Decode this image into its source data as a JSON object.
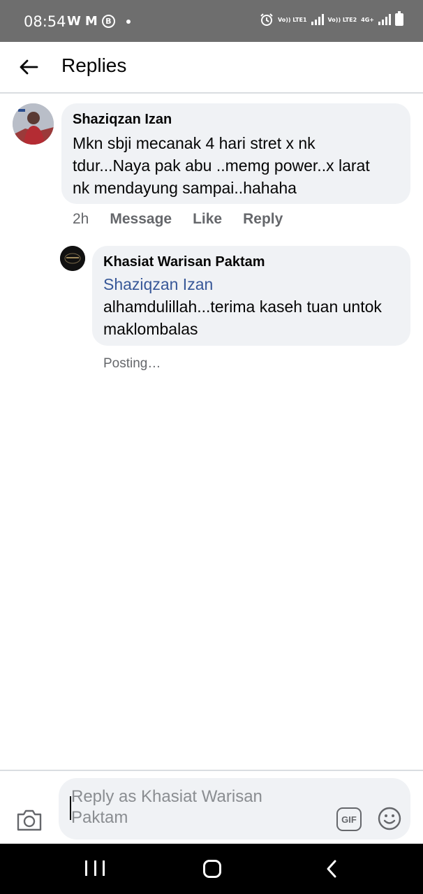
{
  "status_bar": {
    "time": "08:54",
    "left_icons": [
      "W",
      "M",
      "B"
    ],
    "network_1": "Vo)) LTE1",
    "network_2": "Vo)) LTE2",
    "network_3": "4G+"
  },
  "header": {
    "title": "Replies",
    "back_icon": "arrow-left-icon"
  },
  "comments": [
    {
      "author": "Shaziqzan Izan",
      "text": "Mkn sbji mecanak 4 hari stret x nk tdur...Naya pak abu ..memg power..x larat nk mendayung sampai..hahaha",
      "time": "2h",
      "actions": [
        "Message",
        "Like",
        "Reply"
      ]
    },
    {
      "author": "Khasiat Warisan Paktam",
      "mention": "Shaziqzan Izan",
      "text": "alhamdulillah...terima kaseh tuan untok maklombalas",
      "status": "Posting…"
    }
  ],
  "composer": {
    "placeholder": "Reply as Khasiat Warisan Paktam",
    "gif_label": "GIF",
    "camera_icon": "camera-icon",
    "emoji_icon": "smiley-icon"
  },
  "nav_bar": {
    "icons": [
      "recent-apps-icon",
      "home-icon",
      "back-icon"
    ]
  },
  "colors": {
    "status_bar": "#6e6e6e",
    "bubble": "#f0f2f5",
    "mention": "#385898",
    "meta_text": "#65676b"
  }
}
